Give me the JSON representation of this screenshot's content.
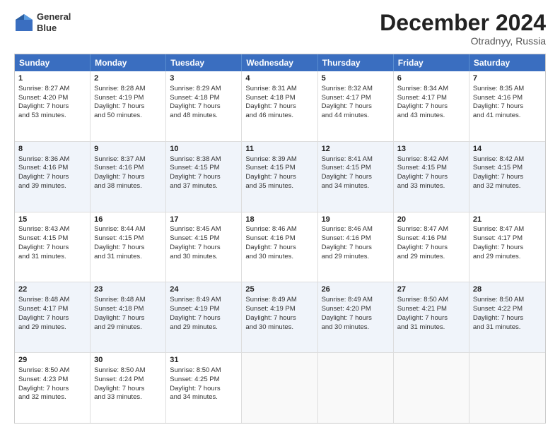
{
  "header": {
    "logo_line1": "General",
    "logo_line2": "Blue",
    "month_title": "December 2024",
    "location": "Otradnyy, Russia"
  },
  "days_of_week": [
    "Sunday",
    "Monday",
    "Tuesday",
    "Wednesday",
    "Thursday",
    "Friday",
    "Saturday"
  ],
  "rows": [
    [
      {
        "day": "1",
        "lines": [
          "Sunrise: 8:27 AM",
          "Sunset: 4:20 PM",
          "Daylight: 7 hours",
          "and 53 minutes."
        ]
      },
      {
        "day": "2",
        "lines": [
          "Sunrise: 8:28 AM",
          "Sunset: 4:19 PM",
          "Daylight: 7 hours",
          "and 50 minutes."
        ]
      },
      {
        "day": "3",
        "lines": [
          "Sunrise: 8:29 AM",
          "Sunset: 4:18 PM",
          "Daylight: 7 hours",
          "and 48 minutes."
        ]
      },
      {
        "day": "4",
        "lines": [
          "Sunrise: 8:31 AM",
          "Sunset: 4:18 PM",
          "Daylight: 7 hours",
          "and 46 minutes."
        ]
      },
      {
        "day": "5",
        "lines": [
          "Sunrise: 8:32 AM",
          "Sunset: 4:17 PM",
          "Daylight: 7 hours",
          "and 44 minutes."
        ]
      },
      {
        "day": "6",
        "lines": [
          "Sunrise: 8:34 AM",
          "Sunset: 4:17 PM",
          "Daylight: 7 hours",
          "and 43 minutes."
        ]
      },
      {
        "day": "7",
        "lines": [
          "Sunrise: 8:35 AM",
          "Sunset: 4:16 PM",
          "Daylight: 7 hours",
          "and 41 minutes."
        ]
      }
    ],
    [
      {
        "day": "8",
        "lines": [
          "Sunrise: 8:36 AM",
          "Sunset: 4:16 PM",
          "Daylight: 7 hours",
          "and 39 minutes."
        ]
      },
      {
        "day": "9",
        "lines": [
          "Sunrise: 8:37 AM",
          "Sunset: 4:16 PM",
          "Daylight: 7 hours",
          "and 38 minutes."
        ]
      },
      {
        "day": "10",
        "lines": [
          "Sunrise: 8:38 AM",
          "Sunset: 4:15 PM",
          "Daylight: 7 hours",
          "and 37 minutes."
        ]
      },
      {
        "day": "11",
        "lines": [
          "Sunrise: 8:39 AM",
          "Sunset: 4:15 PM",
          "Daylight: 7 hours",
          "and 35 minutes."
        ]
      },
      {
        "day": "12",
        "lines": [
          "Sunrise: 8:41 AM",
          "Sunset: 4:15 PM",
          "Daylight: 7 hours",
          "and 34 minutes."
        ]
      },
      {
        "day": "13",
        "lines": [
          "Sunrise: 8:42 AM",
          "Sunset: 4:15 PM",
          "Daylight: 7 hours",
          "and 33 minutes."
        ]
      },
      {
        "day": "14",
        "lines": [
          "Sunrise: 8:42 AM",
          "Sunset: 4:15 PM",
          "Daylight: 7 hours",
          "and 32 minutes."
        ]
      }
    ],
    [
      {
        "day": "15",
        "lines": [
          "Sunrise: 8:43 AM",
          "Sunset: 4:15 PM",
          "Daylight: 7 hours",
          "and 31 minutes."
        ]
      },
      {
        "day": "16",
        "lines": [
          "Sunrise: 8:44 AM",
          "Sunset: 4:15 PM",
          "Daylight: 7 hours",
          "and 31 minutes."
        ]
      },
      {
        "day": "17",
        "lines": [
          "Sunrise: 8:45 AM",
          "Sunset: 4:15 PM",
          "Daylight: 7 hours",
          "and 30 minutes."
        ]
      },
      {
        "day": "18",
        "lines": [
          "Sunrise: 8:46 AM",
          "Sunset: 4:16 PM",
          "Daylight: 7 hours",
          "and 30 minutes."
        ]
      },
      {
        "day": "19",
        "lines": [
          "Sunrise: 8:46 AM",
          "Sunset: 4:16 PM",
          "Daylight: 7 hours",
          "and 29 minutes."
        ]
      },
      {
        "day": "20",
        "lines": [
          "Sunrise: 8:47 AM",
          "Sunset: 4:16 PM",
          "Daylight: 7 hours",
          "and 29 minutes."
        ]
      },
      {
        "day": "21",
        "lines": [
          "Sunrise: 8:47 AM",
          "Sunset: 4:17 PM",
          "Daylight: 7 hours",
          "and 29 minutes."
        ]
      }
    ],
    [
      {
        "day": "22",
        "lines": [
          "Sunrise: 8:48 AM",
          "Sunset: 4:17 PM",
          "Daylight: 7 hours",
          "and 29 minutes."
        ]
      },
      {
        "day": "23",
        "lines": [
          "Sunrise: 8:48 AM",
          "Sunset: 4:18 PM",
          "Daylight: 7 hours",
          "and 29 minutes."
        ]
      },
      {
        "day": "24",
        "lines": [
          "Sunrise: 8:49 AM",
          "Sunset: 4:19 PM",
          "Daylight: 7 hours",
          "and 29 minutes."
        ]
      },
      {
        "day": "25",
        "lines": [
          "Sunrise: 8:49 AM",
          "Sunset: 4:19 PM",
          "Daylight: 7 hours",
          "and 30 minutes."
        ]
      },
      {
        "day": "26",
        "lines": [
          "Sunrise: 8:49 AM",
          "Sunset: 4:20 PM",
          "Daylight: 7 hours",
          "and 30 minutes."
        ]
      },
      {
        "day": "27",
        "lines": [
          "Sunrise: 8:50 AM",
          "Sunset: 4:21 PM",
          "Daylight: 7 hours",
          "and 31 minutes."
        ]
      },
      {
        "day": "28",
        "lines": [
          "Sunrise: 8:50 AM",
          "Sunset: 4:22 PM",
          "Daylight: 7 hours",
          "and 31 minutes."
        ]
      }
    ],
    [
      {
        "day": "29",
        "lines": [
          "Sunrise: 8:50 AM",
          "Sunset: 4:23 PM",
          "Daylight: 7 hours",
          "and 32 minutes."
        ]
      },
      {
        "day": "30",
        "lines": [
          "Sunrise: 8:50 AM",
          "Sunset: 4:24 PM",
          "Daylight: 7 hours",
          "and 33 minutes."
        ]
      },
      {
        "day": "31",
        "lines": [
          "Sunrise: 8:50 AM",
          "Sunset: 4:25 PM",
          "Daylight: 7 hours",
          "and 34 minutes."
        ]
      },
      {
        "day": "",
        "lines": []
      },
      {
        "day": "",
        "lines": []
      },
      {
        "day": "",
        "lines": []
      },
      {
        "day": "",
        "lines": []
      }
    ]
  ]
}
